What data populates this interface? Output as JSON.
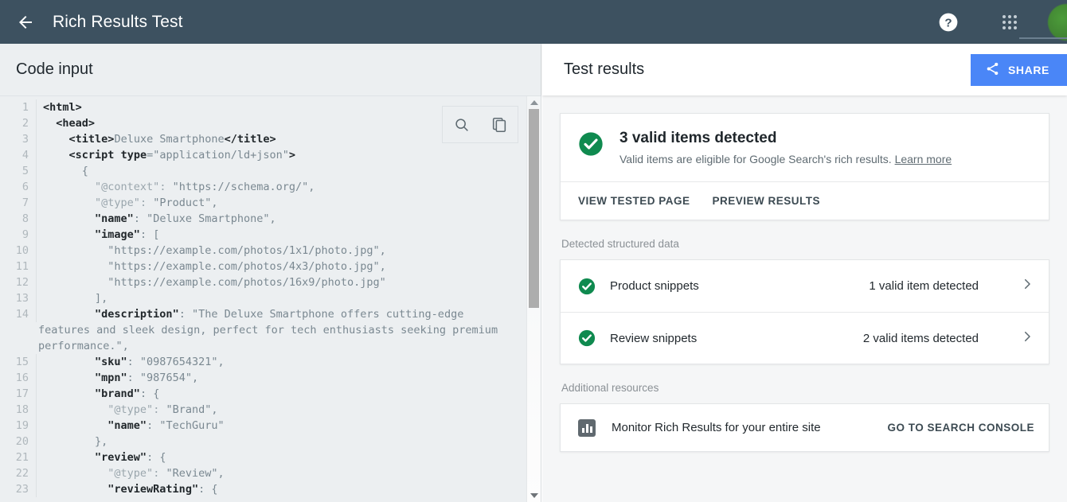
{
  "appbar": {
    "back_icon": "arrow-left-icon",
    "title": "Rich Results Test",
    "help_icon": "help-circle-icon",
    "apps_icon": "apps-grid-icon",
    "avatar_icon": "user-avatar"
  },
  "left_pane": {
    "header": "Code input",
    "tools": {
      "search_icon": "search-icon",
      "copy_icon": "copy-icon"
    },
    "code_lines": [
      {
        "n": "1",
        "text": "<html>"
      },
      {
        "n": "2",
        "text": "  <head>"
      },
      {
        "n": "3",
        "text": "    <title>Deluxe Smartphone</title>"
      },
      {
        "n": "4",
        "text": "    <script type=\"application/ld+json\">"
      },
      {
        "n": "5",
        "text": "      {"
      },
      {
        "n": "6",
        "text": "        \"@context\": \"https://schema.org/\","
      },
      {
        "n": "7",
        "text": "        \"@type\": \"Product\","
      },
      {
        "n": "8",
        "text": "        \"name\": \"Deluxe Smartphone\","
      },
      {
        "n": "9",
        "text": "        \"image\": ["
      },
      {
        "n": "10",
        "text": "          \"https://example.com/photos/1x1/photo.jpg\","
      },
      {
        "n": "11",
        "text": "          \"https://example.com/photos/4x3/photo.jpg\","
      },
      {
        "n": "12",
        "text": "          \"https://example.com/photos/16x9/photo.jpg\""
      },
      {
        "n": "13",
        "text": "        ],"
      },
      {
        "n": "14",
        "text": "        \"description\": \"The Deluxe Smartphone offers cutting-edge"
      },
      {
        "n": "",
        "text": "features and sleek design, perfect for tech enthusiasts seeking premium",
        "wrap": true
      },
      {
        "n": "",
        "text": "performance.\",",
        "wrap": true
      },
      {
        "n": "15",
        "text": "        \"sku\": \"0987654321\","
      },
      {
        "n": "16",
        "text": "        \"mpn\": \"987654\","
      },
      {
        "n": "17",
        "text": "        \"brand\": {"
      },
      {
        "n": "18",
        "text": "          \"@type\": \"Brand\","
      },
      {
        "n": "19",
        "text": "          \"name\": \"TechGuru\""
      },
      {
        "n": "20",
        "text": "        },"
      },
      {
        "n": "21",
        "text": "        \"review\": {"
      },
      {
        "n": "22",
        "text": "          \"@type\": \"Review\","
      },
      {
        "n": "23",
        "text": "          \"reviewRating\": {"
      }
    ],
    "scrollbar": {
      "up_icon": "scroll-up-arrow-icon",
      "down_icon": "scroll-down-arrow-icon"
    }
  },
  "right_pane": {
    "header": {
      "title": "Test results",
      "share_label": "SHARE",
      "share_icon": "share-icon",
      "share_color": "#4a86f7"
    },
    "summary": {
      "status_icon": "check-circle-icon",
      "status_color": "#0f8a4f",
      "heading": "3 valid items detected",
      "subtext": "Valid items are eligible for Google Search's rich results. ",
      "learn_more": "Learn more",
      "actions": [
        "VIEW TESTED PAGE",
        "PREVIEW RESULTS"
      ]
    },
    "structured_data": {
      "label": "Detected structured data",
      "rows": [
        {
          "icon": "check-circle-icon",
          "name": "Product snippets",
          "count": "1 valid item detected",
          "chevron": "chevron-right-icon"
        },
        {
          "icon": "check-circle-icon",
          "name": "Review snippets",
          "count": "2 valid items detected",
          "chevron": "chevron-right-icon"
        }
      ]
    },
    "additional_resources": {
      "label": "Additional resources",
      "icon": "bar-chart-icon",
      "text": "Monitor Rich Results for your entire site",
      "action": "GO TO SEARCH CONSOLE"
    }
  }
}
